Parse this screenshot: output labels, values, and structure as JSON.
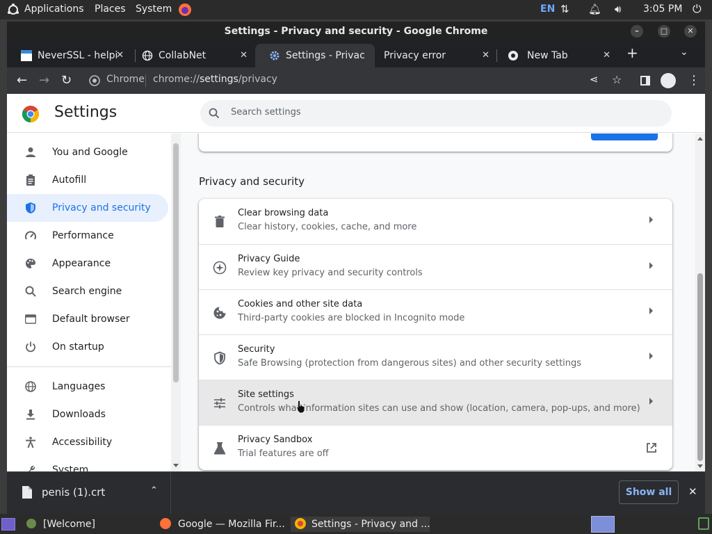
{
  "top_panel": {
    "menus": [
      "Applications",
      "Places",
      "System"
    ],
    "keyboard_layout": "EN",
    "clock": "3:05 PM"
  },
  "window": {
    "title": "Settings - Privacy and security - Google Chrome"
  },
  "tabs": [
    {
      "label": "NeverSSL - helpi",
      "icon": "neverssl-favicon"
    },
    {
      "label": "CollabNet",
      "icon": "globe-icon"
    },
    {
      "label": "Settings - Privac",
      "icon": "gear-icon",
      "active": true
    },
    {
      "label": "Privacy error",
      "icon": ""
    },
    {
      "label": "New Tab",
      "icon": "chrome-icon"
    }
  ],
  "toolbar": {
    "site_chip": "Chrome",
    "url_prefix": "chrome://",
    "url_host": "settings",
    "url_path": "/privacy"
  },
  "settings": {
    "title": "Settings",
    "search_placeholder": "Search settings"
  },
  "sidebar": {
    "items": [
      {
        "label": "You and Google",
        "icon": "person-icon"
      },
      {
        "label": "Autofill",
        "icon": "clipboard-icon"
      },
      {
        "label": "Privacy and security",
        "icon": "shield-icon",
        "active": true
      },
      {
        "label": "Performance",
        "icon": "speedometer-icon"
      },
      {
        "label": "Appearance",
        "icon": "palette-icon"
      },
      {
        "label": "Search engine",
        "icon": "search-icon"
      },
      {
        "label": "Default browser",
        "icon": "browser-icon"
      },
      {
        "label": "On startup",
        "icon": "power-icon"
      },
      {
        "label": "Languages",
        "icon": "globe-icon"
      },
      {
        "label": "Downloads",
        "icon": "download-icon"
      },
      {
        "label": "Accessibility",
        "icon": "accessibility-icon"
      },
      {
        "label": "System",
        "icon": "wrench-icon"
      }
    ]
  },
  "main": {
    "section_title": "Privacy and security",
    "rows": [
      {
        "title": "Clear browsing data",
        "subtitle": "Clear history, cookies, cache, and more",
        "icon": "trash-icon",
        "action": "arrow"
      },
      {
        "title": "Privacy Guide",
        "subtitle": "Review key privacy and security controls",
        "icon": "compass-icon",
        "action": "arrow"
      },
      {
        "title": "Cookies and other site data",
        "subtitle": "Third-party cookies are blocked in Incognito mode",
        "icon": "cookie-icon",
        "action": "arrow"
      },
      {
        "title": "Security",
        "subtitle": "Safe Browsing (protection from dangerous sites) and other security settings",
        "icon": "shield-outline-icon",
        "action": "arrow"
      },
      {
        "title": "Site settings",
        "subtitle": "Controls what information sites can use and show (location, camera, pop-ups, and more)",
        "icon": "sliders-icon",
        "action": "arrow",
        "hovered": true
      },
      {
        "title": "Privacy Sandbox",
        "subtitle": "Trial features are off",
        "icon": "flask-icon",
        "action": "external-link"
      }
    ]
  },
  "downloads_bar": {
    "file_name": "penis (1).crt",
    "show_all": "Show all"
  },
  "taskbar": {
    "items": [
      "[Welcome]",
      "Google — Mozilla Fir...",
      "Settings - Privacy and ..."
    ]
  },
  "colors": {
    "accent": "#1a73e8",
    "active_nav_bg": "#e8f0fe",
    "hover_row_bg": "#e8e8e8",
    "show_all_text": "#8ab4f8"
  }
}
